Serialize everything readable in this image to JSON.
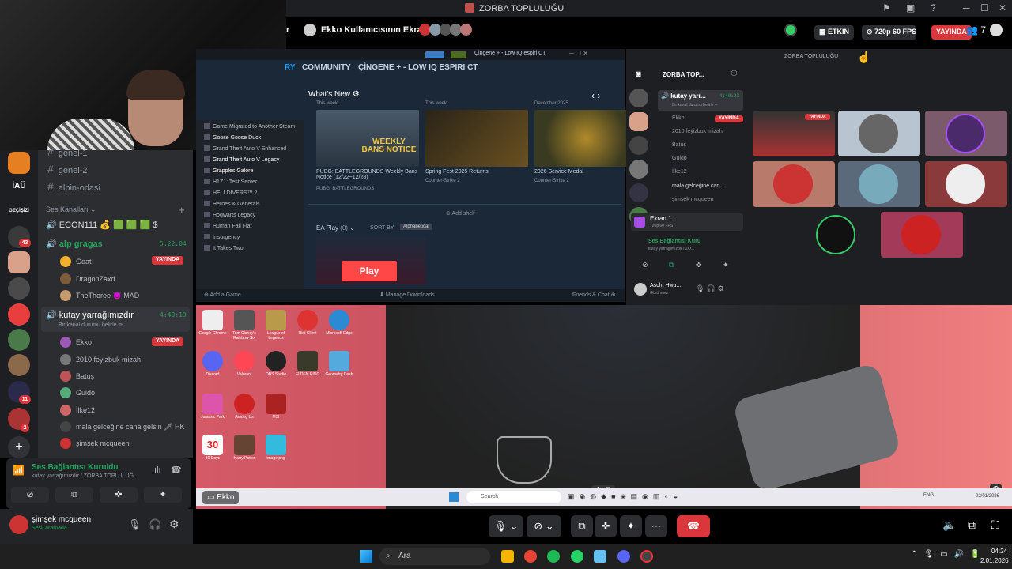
{
  "window": {
    "title": "ZORBA TOPLULUĞU"
  },
  "stream_header": {
    "prefix": "r",
    "title": "Ekko Kullanıcısının Ekranı",
    "activity_label": "ETKİN",
    "quality": "720p 60 FPS",
    "live_label": "YAYINDA",
    "viewer_count": "7"
  },
  "servers": {
    "items": [
      {
        "label": "İAÜ"
      },
      {
        "label": "GEÇİŞİZİ"
      }
    ],
    "badges": [
      "43",
      "11",
      "2"
    ]
  },
  "channels": {
    "text_channels": [
      "genel-1",
      "genel-2",
      "alpin-odasi"
    ],
    "voice_category": "Ses Kanalları",
    "voice": [
      {
        "name": "ECON111",
        "suffix": "💰 🟩 🟩 🟩 $"
      },
      {
        "name": "alp gragas",
        "time": "5:22:04",
        "users": [
          {
            "name": "Goat",
            "live": "YAYINDA",
            "color": "#f0b132"
          },
          {
            "name": "DragonZaxd",
            "color": "#7c5c3a"
          },
          {
            "name": "TheThoree",
            "extra": "😈 MAD",
            "color": "#c59a6d"
          }
        ]
      },
      {
        "name": "kutay yarrağımızdır",
        "status": "Bir kanal durumu belirle ✏",
        "time": "4:40:19",
        "users": [
          {
            "name": "Ekko",
            "live": "YAYINDA",
            "color": "#9b59b6"
          },
          {
            "name": "2010 feyizbuk mizah",
            "color": "#777"
          },
          {
            "name": "Batuş",
            "color": "#b55"
          },
          {
            "name": "Guido",
            "color": "#5a7"
          },
          {
            "name": "İlke12",
            "color": "#c66"
          },
          {
            "name": "mala gelceğine cana gelsin",
            "extra": "🗡 HK",
            "color": "#444"
          },
          {
            "name": "şimşek mcqueen",
            "color": "#c33"
          }
        ]
      }
    ]
  },
  "voice_panel": {
    "title": "Ses Bağlantısı Kuruldu",
    "subtitle": "kutay yarrağımızdır / ZORBA TOPLULUĞ..."
  },
  "user_panel": {
    "name": "şimşek mcqueen",
    "status": "Sesli aramada"
  },
  "steam": {
    "tabs": [
      "RY",
      "COMMUNITY",
      "ÇİNGENE + - LOW IQ ESPIRI CT"
    ],
    "top_title": "Çingene + - Low IQ espiri CT",
    "whats_new": "What's New ⚙",
    "sections": [
      "This week",
      "This week",
      "December 2025"
    ],
    "news": [
      {
        "title": "PUBG: BATTLEGROUNDS Weekly Bans Notice (12/22~12/28)",
        "game": "PUBG: BATTLEGROUNDS",
        "img_text": "WEEKLY BANS NOTICE"
      },
      {
        "title": "Spring Fest 2025 Returns",
        "game": "Counter-Strike 2"
      },
      {
        "title": "2026 Service Medal",
        "game": "Counter-Strike 2"
      }
    ],
    "library": [
      "Game Migrated to Another Steam",
      "Goose Goose Duck",
      "Grand Theft Auto V Enhanced",
      "Grand Theft Auto V Legacy",
      "Grapples Galore",
      "H1Z1: Test Server",
      "HELLDIVERS™ 2",
      "Heroes & Generals",
      "Hogwarts Legacy",
      "Human Fall Flat",
      "Insurgency",
      "It Takes Two"
    ],
    "add_shelf": "⊕ Add shelf",
    "ea_play": "EA Play",
    "ea_count": "(0)",
    "sort_by": "SORT BY",
    "sort_value": "Alphabetical",
    "ea_logo": "Play",
    "add_game": "Add a Game",
    "manage_downloads": "Manage Downloads",
    "friends_chat": "Friends & Chat"
  },
  "mini_discord": {
    "server": "ZORBA TOP...",
    "window_title": "ZORBA TOPLULUĞU",
    "channel": "kutay yarr...",
    "channel_time": "4:40:23",
    "channel_status": "Bir kanal durumu belirle ✏",
    "users": [
      "Ekko",
      "2010 feyizbuk mizah",
      "Batuş",
      "Guido",
      "İlke12",
      "mala gelceğine can...",
      "şimşek mcqueen"
    ],
    "live": "YAYINDA",
    "screen": "Ekran 1",
    "screen_sub": "720p 60 FPS",
    "conn_title": "Ses Bağlantısı Kuru",
    "conn_sub": "kutay yarrağımızdır / ZO...",
    "me_name": "Ascht Hwu...",
    "me_status": "Görünmez",
    "tile_live": "YAYINDA"
  },
  "desktop": {
    "icons": [
      "Google Chrome",
      "Tom Clancy's Rainbow Six",
      "League of Legends",
      "Riot Client",
      "Microsoft Edge",
      "Discord",
      "Valorant",
      "OBS Studio",
      "ELDEN RING",
      "Geometry Dash",
      "Jurassic Park",
      "Among Us",
      "MSI",
      "30 Days",
      "Harry Potter",
      "image.png"
    ],
    "taskbar_search": "Search",
    "stream_label": "Ekko",
    "tray_lang": "ENG",
    "tray_date": "02/01/2026"
  },
  "taskbar": {
    "search": "Ara",
    "time": "04:24",
    "date": "2.01.2026"
  }
}
